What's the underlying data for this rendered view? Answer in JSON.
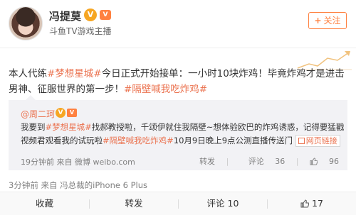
{
  "user": {
    "name": "冯提莫",
    "subtitle": "斗鱼TV游戏主播",
    "follow_label": "关注",
    "verified_mark": "V",
    "vip_mark": "V"
  },
  "post": {
    "segments": [
      {
        "text": "本人代练",
        "topic": false
      },
      {
        "text": "#梦想星城#",
        "topic": true
      },
      {
        "text": "今日正式开始接单：一小时10块炸鸡！毕竟炸鸡才是进击男神、征服世界的第一步！",
        "topic": false
      },
      {
        "text": "#隔壁喊我吃炸鸡#",
        "topic": true
      }
    ],
    "meta": "3分钟前 来自 冯总裁的iPhone 6 Plus"
  },
  "quote": {
    "user": "@周二珂",
    "text_a": "我要到",
    "topic1": "#梦想星城#",
    "text_b": "找郝教授啦，千颂伊就住我隔壁~想体验欧巴的炸鸡诱惑，记得要猛戳视频君观看我的试玩啦",
    "topic2": "#隔壁喊我吃炸鸡#",
    "text_c": "10月9日晚上9点公测直播传送门",
    "link_label": "网页链接",
    "meta": "19分钟前 来自 微博 weibo.com",
    "repost_label": "转发",
    "comment_label": "评论",
    "comment_count": "36",
    "like_count": "96"
  },
  "actions": {
    "collect": "收藏",
    "repost": "转发",
    "comment": "评论",
    "comment_count": "10",
    "like_count": "17"
  },
  "colors": {
    "accent": "#ff8140",
    "topic": "#eb7350"
  }
}
